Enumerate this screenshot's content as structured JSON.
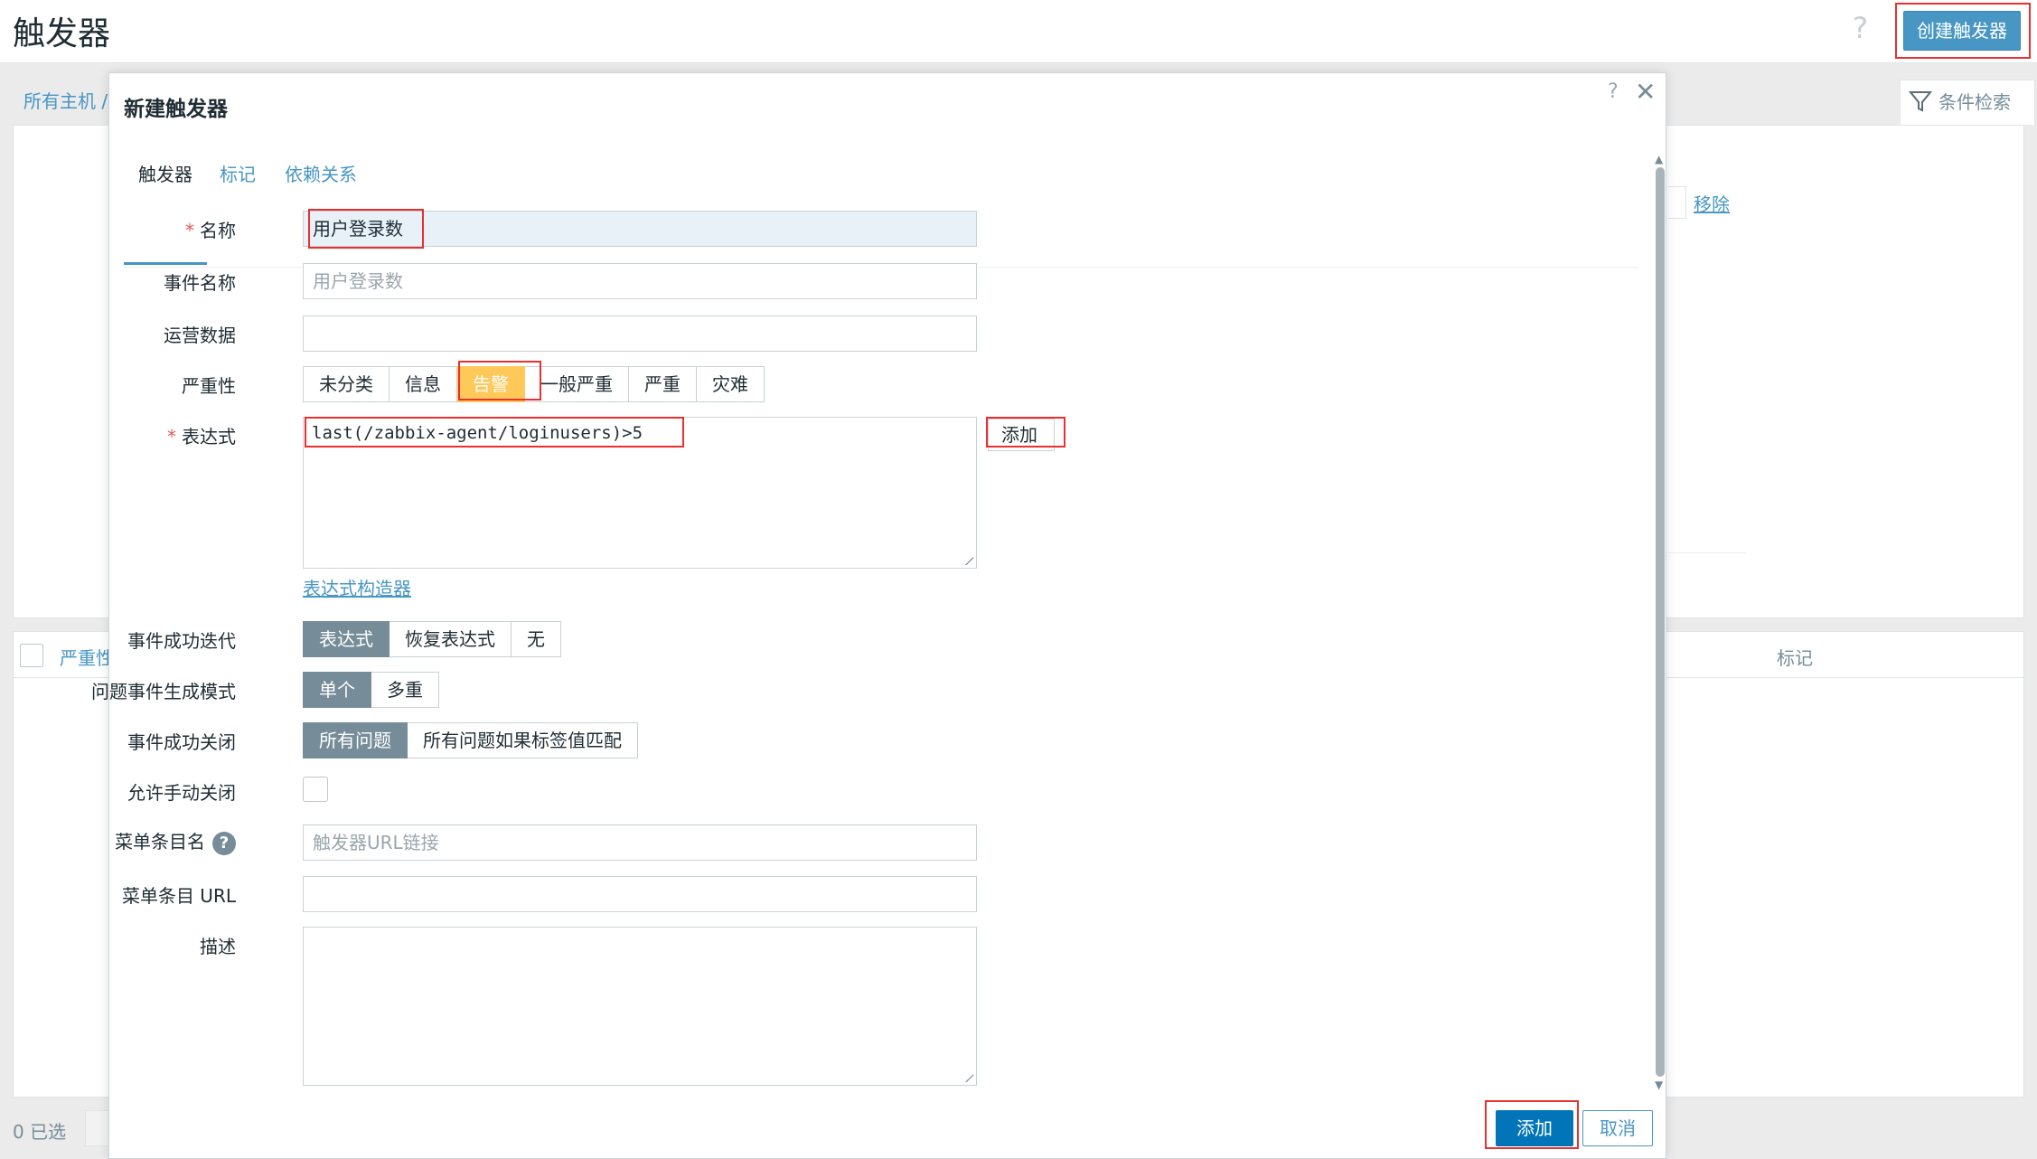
{
  "page": {
    "title": "触发器",
    "help": "?",
    "create_button": "创建触发器",
    "breadcrumb": "所有主机 /",
    "filter_tab": "条件检索",
    "remove_link": "移除",
    "table_header_severity": "严重性",
    "table_header_tags": "标记",
    "selected_count": "0 已选"
  },
  "modal": {
    "title": "新建触发器",
    "help": "?",
    "close": "✕",
    "tabs": [
      "触发器",
      "标记",
      "依赖关系"
    ],
    "form": {
      "name_label": "名称",
      "name_value": "用户登录数",
      "event_name_label": "事件名称",
      "event_name_placeholder": "用户登录数",
      "opdata_label": "运营数据",
      "severity_label": "严重性",
      "severity_options": [
        "未分类",
        "信息",
        "告警",
        "一般严重",
        "严重",
        "灾难"
      ],
      "severity_selected": "告警",
      "expression_label": "表达式",
      "expression_value": "last(/zabbix-agent/loginusers)>5",
      "expression_add": "添加",
      "expression_constructor": "表达式构造器",
      "ok_event_gen_label": "事件成功迭代",
      "ok_event_gen_options": [
        "表达式",
        "恢复表达式",
        "无"
      ],
      "ok_event_gen_selected": "表达式",
      "problem_mode_label": "问题事件生成模式",
      "problem_mode_options": [
        "单个",
        "多重"
      ],
      "problem_mode_selected": "单个",
      "ok_close_label": "事件成功关闭",
      "ok_close_options": [
        "所有问题",
        "所有问题如果标签值匹配"
      ],
      "ok_close_selected": "所有问题",
      "manual_close_label": "允许手动关闭",
      "manual_close_checked": false,
      "url_name_label": "菜单条目名",
      "url_name_placeholder": "触发器URL链接",
      "url_label": "菜单条目 URL",
      "description_label": "描述"
    },
    "buttons": {
      "add": "添加",
      "cancel": "取消"
    }
  },
  "colors": {
    "accent": "#4796c4",
    "primary": "#0275b8",
    "warning": "#ffc859",
    "segment_active": "#768d99",
    "highlight_box": "#e8312f"
  }
}
